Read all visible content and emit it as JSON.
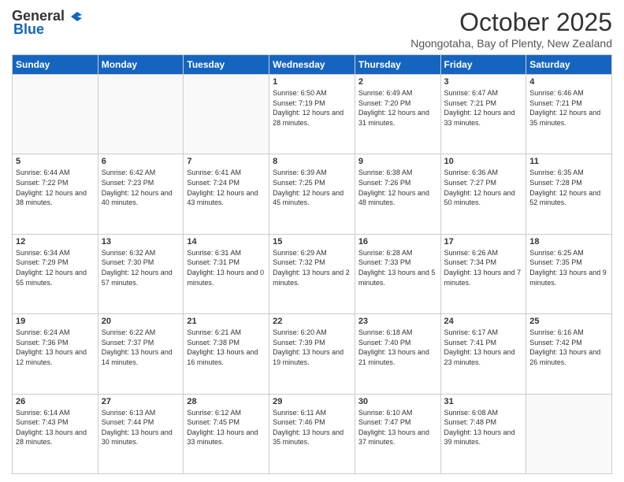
{
  "header": {
    "logo_general": "General",
    "logo_blue": "Blue",
    "month_title": "October 2025",
    "subtitle": "Ngongotaha, Bay of Plenty, New Zealand"
  },
  "days_of_week": [
    "Sunday",
    "Monday",
    "Tuesday",
    "Wednesday",
    "Thursday",
    "Friday",
    "Saturday"
  ],
  "weeks": [
    [
      {
        "day": "",
        "empty": true
      },
      {
        "day": "",
        "empty": true
      },
      {
        "day": "",
        "empty": true
      },
      {
        "day": "1",
        "sunrise": "Sunrise: 6:50 AM",
        "sunset": "Sunset: 7:19 PM",
        "daylight": "Daylight: 12 hours and 28 minutes."
      },
      {
        "day": "2",
        "sunrise": "Sunrise: 6:49 AM",
        "sunset": "Sunset: 7:20 PM",
        "daylight": "Daylight: 12 hours and 31 minutes."
      },
      {
        "day": "3",
        "sunrise": "Sunrise: 6:47 AM",
        "sunset": "Sunset: 7:21 PM",
        "daylight": "Daylight: 12 hours and 33 minutes."
      },
      {
        "day": "4",
        "sunrise": "Sunrise: 6:46 AM",
        "sunset": "Sunset: 7:21 PM",
        "daylight": "Daylight: 12 hours and 35 minutes."
      }
    ],
    [
      {
        "day": "5",
        "sunrise": "Sunrise: 6:44 AM",
        "sunset": "Sunset: 7:22 PM",
        "daylight": "Daylight: 12 hours and 38 minutes."
      },
      {
        "day": "6",
        "sunrise": "Sunrise: 6:42 AM",
        "sunset": "Sunset: 7:23 PM",
        "daylight": "Daylight: 12 hours and 40 minutes."
      },
      {
        "day": "7",
        "sunrise": "Sunrise: 6:41 AM",
        "sunset": "Sunset: 7:24 PM",
        "daylight": "Daylight: 12 hours and 43 minutes."
      },
      {
        "day": "8",
        "sunrise": "Sunrise: 6:39 AM",
        "sunset": "Sunset: 7:25 PM",
        "daylight": "Daylight: 12 hours and 45 minutes."
      },
      {
        "day": "9",
        "sunrise": "Sunrise: 6:38 AM",
        "sunset": "Sunset: 7:26 PM",
        "daylight": "Daylight: 12 hours and 48 minutes."
      },
      {
        "day": "10",
        "sunrise": "Sunrise: 6:36 AM",
        "sunset": "Sunset: 7:27 PM",
        "daylight": "Daylight: 12 hours and 50 minutes."
      },
      {
        "day": "11",
        "sunrise": "Sunrise: 6:35 AM",
        "sunset": "Sunset: 7:28 PM",
        "daylight": "Daylight: 12 hours and 52 minutes."
      }
    ],
    [
      {
        "day": "12",
        "sunrise": "Sunrise: 6:34 AM",
        "sunset": "Sunset: 7:29 PM",
        "daylight": "Daylight: 12 hours and 55 minutes."
      },
      {
        "day": "13",
        "sunrise": "Sunrise: 6:32 AM",
        "sunset": "Sunset: 7:30 PM",
        "daylight": "Daylight: 12 hours and 57 minutes."
      },
      {
        "day": "14",
        "sunrise": "Sunrise: 6:31 AM",
        "sunset": "Sunset: 7:31 PM",
        "daylight": "Daylight: 13 hours and 0 minutes."
      },
      {
        "day": "15",
        "sunrise": "Sunrise: 6:29 AM",
        "sunset": "Sunset: 7:32 PM",
        "daylight": "Daylight: 13 hours and 2 minutes."
      },
      {
        "day": "16",
        "sunrise": "Sunrise: 6:28 AM",
        "sunset": "Sunset: 7:33 PM",
        "daylight": "Daylight: 13 hours and 5 minutes."
      },
      {
        "day": "17",
        "sunrise": "Sunrise: 6:26 AM",
        "sunset": "Sunset: 7:34 PM",
        "daylight": "Daylight: 13 hours and 7 minutes."
      },
      {
        "day": "18",
        "sunrise": "Sunrise: 6:25 AM",
        "sunset": "Sunset: 7:35 PM",
        "daylight": "Daylight: 13 hours and 9 minutes."
      }
    ],
    [
      {
        "day": "19",
        "sunrise": "Sunrise: 6:24 AM",
        "sunset": "Sunset: 7:36 PM",
        "daylight": "Daylight: 13 hours and 12 minutes."
      },
      {
        "day": "20",
        "sunrise": "Sunrise: 6:22 AM",
        "sunset": "Sunset: 7:37 PM",
        "daylight": "Daylight: 13 hours and 14 minutes."
      },
      {
        "day": "21",
        "sunrise": "Sunrise: 6:21 AM",
        "sunset": "Sunset: 7:38 PM",
        "daylight": "Daylight: 13 hours and 16 minutes."
      },
      {
        "day": "22",
        "sunrise": "Sunrise: 6:20 AM",
        "sunset": "Sunset: 7:39 PM",
        "daylight": "Daylight: 13 hours and 19 minutes."
      },
      {
        "day": "23",
        "sunrise": "Sunrise: 6:18 AM",
        "sunset": "Sunset: 7:40 PM",
        "daylight": "Daylight: 13 hours and 21 minutes."
      },
      {
        "day": "24",
        "sunrise": "Sunrise: 6:17 AM",
        "sunset": "Sunset: 7:41 PM",
        "daylight": "Daylight: 13 hours and 23 minutes."
      },
      {
        "day": "25",
        "sunrise": "Sunrise: 6:16 AM",
        "sunset": "Sunset: 7:42 PM",
        "daylight": "Daylight: 13 hours and 26 minutes."
      }
    ],
    [
      {
        "day": "26",
        "sunrise": "Sunrise: 6:14 AM",
        "sunset": "Sunset: 7:43 PM",
        "daylight": "Daylight: 13 hours and 28 minutes."
      },
      {
        "day": "27",
        "sunrise": "Sunrise: 6:13 AM",
        "sunset": "Sunset: 7:44 PM",
        "daylight": "Daylight: 13 hours and 30 minutes."
      },
      {
        "day": "28",
        "sunrise": "Sunrise: 6:12 AM",
        "sunset": "Sunset: 7:45 PM",
        "daylight": "Daylight: 13 hours and 33 minutes."
      },
      {
        "day": "29",
        "sunrise": "Sunrise: 6:11 AM",
        "sunset": "Sunset: 7:46 PM",
        "daylight": "Daylight: 13 hours and 35 minutes."
      },
      {
        "day": "30",
        "sunrise": "Sunrise: 6:10 AM",
        "sunset": "Sunset: 7:47 PM",
        "daylight": "Daylight: 13 hours and 37 minutes."
      },
      {
        "day": "31",
        "sunrise": "Sunrise: 6:08 AM",
        "sunset": "Sunset: 7:48 PM",
        "daylight": "Daylight: 13 hours and 39 minutes."
      },
      {
        "day": "",
        "empty": true
      }
    ]
  ]
}
